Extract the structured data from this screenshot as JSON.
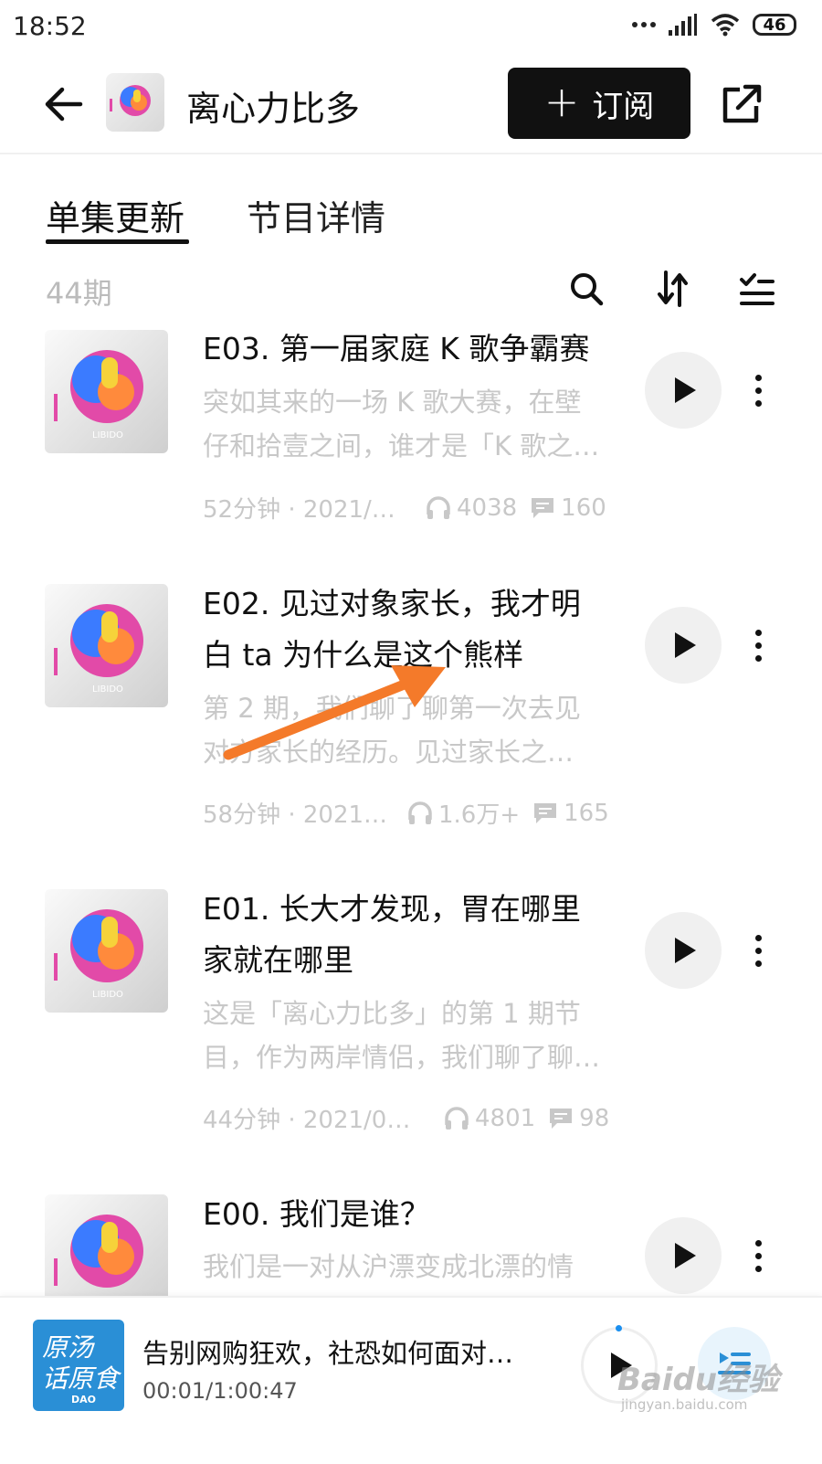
{
  "status_bar": {
    "time": "18:52",
    "battery": "46"
  },
  "header": {
    "title": "离心力比多",
    "subscribe_label": "订阅"
  },
  "tabs": [
    {
      "label": "单集更新",
      "active": true
    },
    {
      "label": "节目详情",
      "active": false
    }
  ],
  "list_toolbar": {
    "count": "44期"
  },
  "episodes": [
    {
      "title_lines": [
        "E03. 第一届家庭 K 歌争霸赛"
      ],
      "desc_lines": [
        "突如其来的一场 K 歌大赛，在壁",
        "仔和拾壹之间，谁才是「K 歌之…"
      ],
      "duration_date": "52分钟 · 2021/…",
      "plays": "4038",
      "comments": "160"
    },
    {
      "title_lines": [
        "E02. 见过对象家长，我才明",
        "白 ta 为什么是这个熊样"
      ],
      "desc_lines": [
        "第 2 期，我们聊了聊第一次去见",
        "对方家长的经历。见过家长之…"
      ],
      "duration_date": "58分钟 · 2021…",
      "plays": "1.6万+",
      "comments": "165"
    },
    {
      "title_lines": [
        "E01. 长大才发现，胃在哪里",
        "家就在哪里"
      ],
      "desc_lines": [
        "这是「离心力比多」的第 1 期节",
        "目，作为两岸情侣，我们聊了聊…"
      ],
      "duration_date": "44分钟 · 2021/0…",
      "plays": "4801",
      "comments": "98"
    },
    {
      "title_lines": [
        "E00. 我们是谁？"
      ],
      "desc_lines": [
        "我们是一对从沪漂变成北漂的情"
      ],
      "duration_date": "",
      "plays": "",
      "comments": ""
    }
  ],
  "player": {
    "title": "告别网购狂欢，社恐如何面对…",
    "time": "00:01/1:00:47",
    "cover_text_line1": "原汤",
    "cover_text_line2": "话原食",
    "cover_tag": "DAO"
  },
  "cover_logo_text": "LIBIDO",
  "watermark": {
    "main": "Baidu经验",
    "sub": "jingyan.baidu.com"
  },
  "colors": {
    "accent_button": "#111111",
    "muted_text": "#c8c8c8",
    "annotation_arrow": "#f47a2a",
    "player_cover": "#2a8fd6",
    "progress_dot": "#1a8ff0"
  },
  "icons": [
    "back-arrow-icon",
    "share-icon",
    "search-icon",
    "sort-icon",
    "multi-select-icon",
    "play-icon",
    "more-icon",
    "headphone-icon",
    "comment-icon",
    "queue-icon"
  ]
}
